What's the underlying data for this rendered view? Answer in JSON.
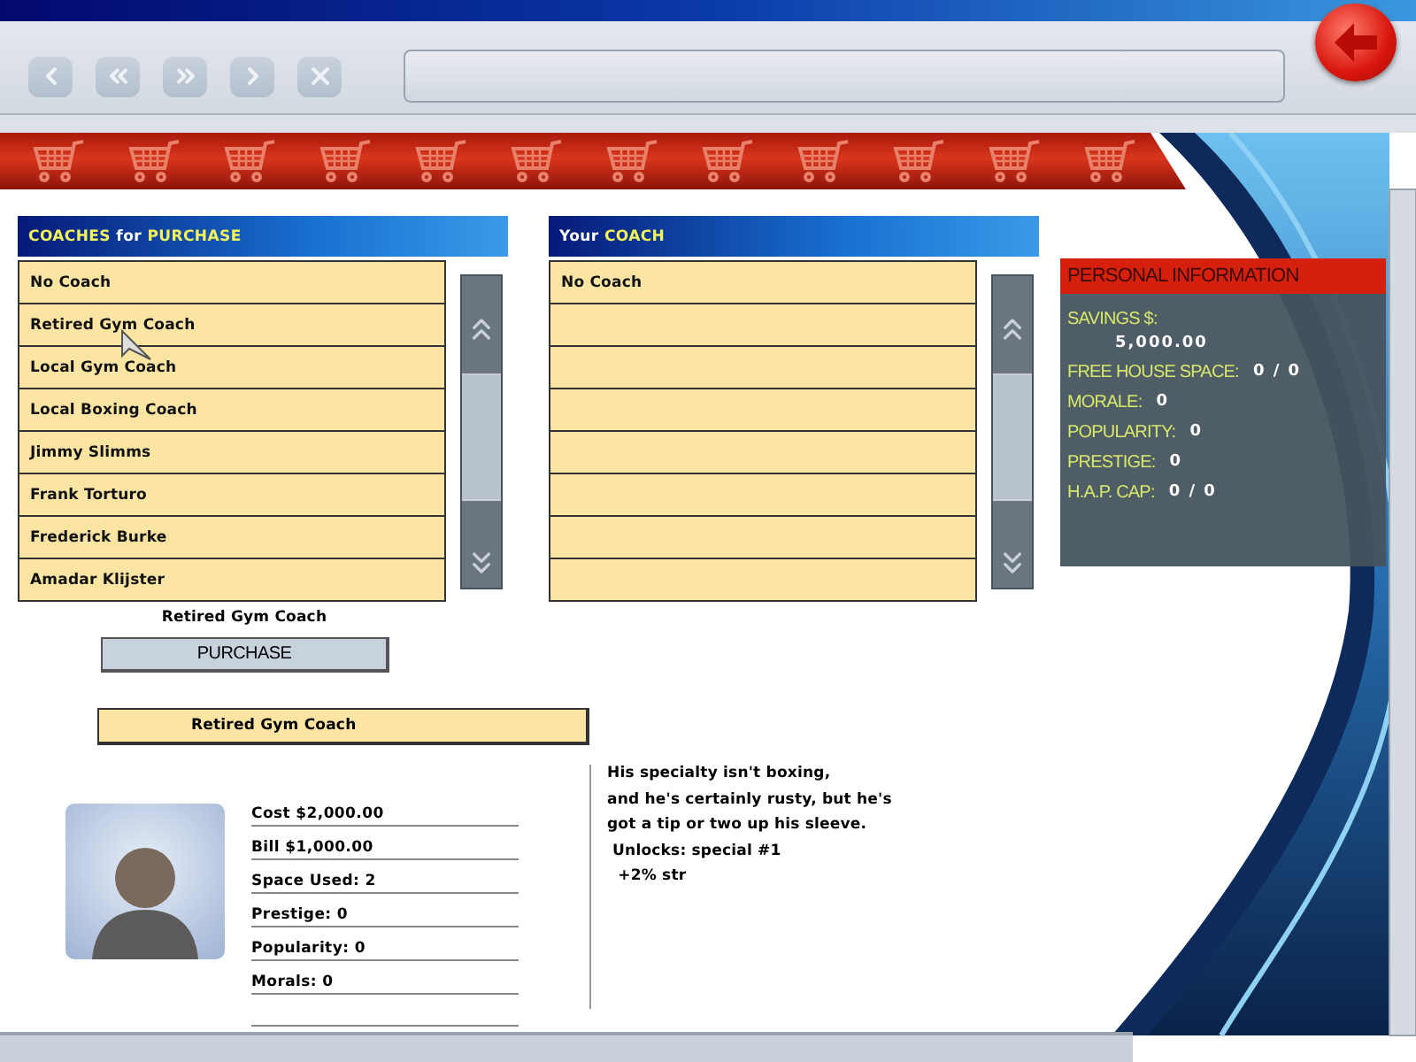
{
  "coaches_for_purchase": {
    "title": [
      {
        "text": "COACHES",
        "highlight": true
      },
      {
        "text": "for",
        "highlight": false
      },
      {
        "text": "PURCHASE",
        "highlight": true
      }
    ],
    "items": [
      "No Coach",
      "Retired Gym Coach",
      "Local Gym Coach",
      "Local Boxing Coach",
      "Jimmy Slimms",
      "Frank Torturo",
      "Frederick Burke",
      "Amadar Klijster"
    ]
  },
  "your_coach": {
    "title": [
      {
        "text": "Your",
        "highlight": false
      },
      {
        "text": "COACH",
        "highlight": true
      }
    ],
    "items": [
      "No Coach"
    ]
  },
  "personal_information": {
    "title": "PERSONAL INFORMATION",
    "rows": [
      {
        "label": "SAVINGS $:",
        "value": "5,000.00",
        "kind": "stacked"
      },
      {
        "label": "FREE HOUSE SPACE:",
        "value": "0 / 0",
        "kind": "inline"
      },
      {
        "label": "MORALE:",
        "value": "0",
        "kind": "inline"
      },
      {
        "label": "POPULARITY:",
        "value": "0",
        "kind": "inline"
      },
      {
        "label": "PRESTIGE:",
        "value": "0",
        "kind": "inline"
      },
      {
        "label": "H.A.P. CAP:",
        "value": "0 / 0",
        "kind": "inline"
      }
    ]
  },
  "selection": {
    "caption": "Retired Gym Coach",
    "purchase_button": "PURCHASE",
    "name_bar": "Retired Gym Coach",
    "stats": [
      "Cost $2,000.00",
      "Bill $1,000.00",
      "Space Used: 2",
      "Prestige: 0",
      "Popularity: 0",
      "Morals: 0"
    ],
    "description": [
      "His specialty isn't boxing,",
      "and he's certainly rusty, but he's",
      "got a tip or two up his sleeve.",
      " Unlocks: special #1",
      "  +2% str"
    ]
  }
}
